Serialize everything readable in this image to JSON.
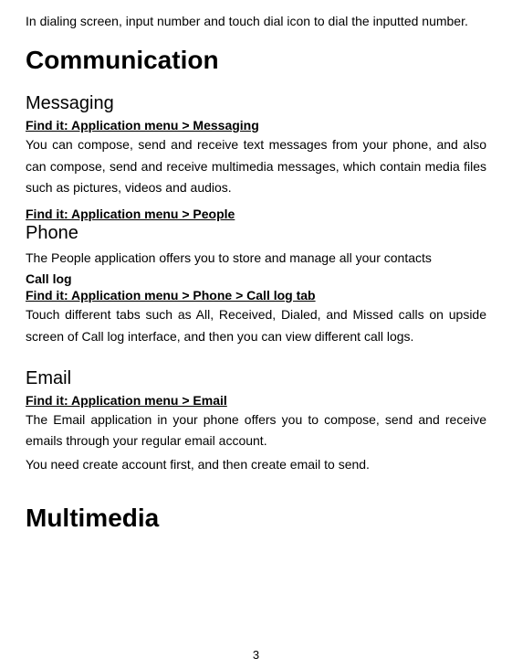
{
  "intro": "In dialing screen, input number and touch dial icon to dial the inputted number.",
  "sections": {
    "communication": {
      "heading": "Communication",
      "messaging": {
        "heading": "Messaging",
        "findIt": "Find it: Application menu > Messaging",
        "body": "You can compose, send and receive text messages from your phone, and also can compose, send and receive multimedia messages, which contain media files such as pictures, videos and audios."
      },
      "people": {
        "findIt": "Find it: Application menu > People",
        "heading": "Phone",
        "body": "The People application offers you to store and manage all your contacts"
      },
      "callLog": {
        "subhead": "Call log",
        "findIt": "Find it: Application menu > Phone > Call log tab",
        "body": "Touch different tabs such as All, Received, Dialed, and Missed calls on upside screen of Call log interface, and then you can view different call logs."
      },
      "email": {
        "heading": "Email",
        "findIt": "Find it: Application menu > Email",
        "body1": "The Email application in your phone offers you to compose, send and receive emails through your regular email account.",
        "body2": "You need create account first, and then create email to send."
      }
    },
    "multimedia": {
      "heading": "Multimedia"
    }
  },
  "pageNumber": "3"
}
